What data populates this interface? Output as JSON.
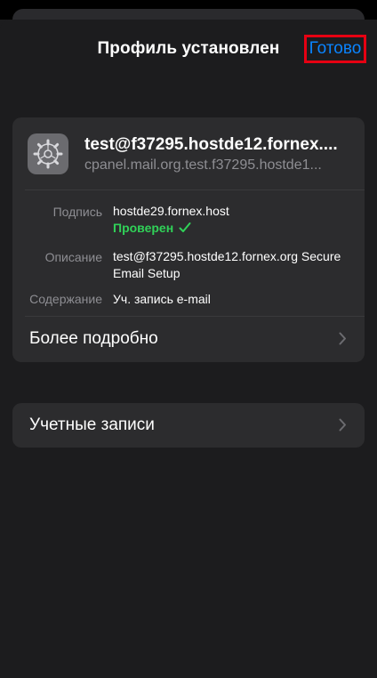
{
  "header": {
    "title": "Профиль установлен",
    "done_label": "Готово"
  },
  "profile": {
    "icon": "settings-gear-icon",
    "name": "test@f37295.hostde12.fornex....",
    "identifier": "cpanel.mail.org.test.f37295.hostde1...",
    "details": {
      "signature_label": "Подпись",
      "signature_value": "hostde29.fornex.host",
      "verified_label": "Проверен",
      "description_label": "Описание",
      "description_value": "test@f37295.hostde12.fornex.org Secure Email Setup",
      "contents_label": "Содержание",
      "contents_value": "Уч. запись e-mail"
    },
    "more_details_label": "Более подробно"
  },
  "accounts": {
    "label": "Учетные записи"
  },
  "colors": {
    "accent": "#0a84ff",
    "verified": "#30d158",
    "highlight_box": "#e60012"
  }
}
